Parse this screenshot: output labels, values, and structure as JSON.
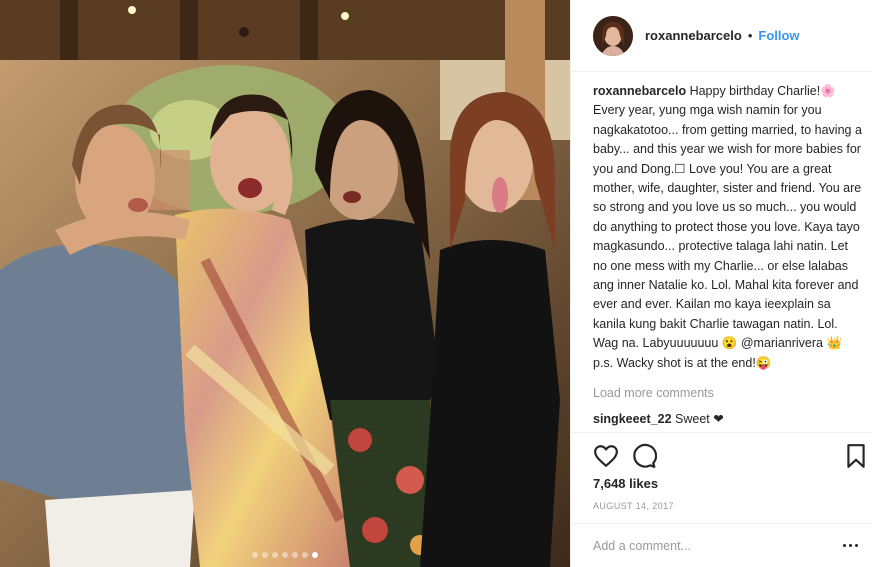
{
  "post": {
    "username": "roxannebarcelo",
    "follow_label": "Follow",
    "separator": "•",
    "caption_text": "Happy birthday Charlie!🌸 Every year, yung mga wish namin for you nagkakatotoo... from getting married, to having a baby... and this year we wish for more babies for you and Dong.☐ Love you! You are a great mother, wife, daughter, sister and friend. You are so strong and you love us so much... you would do anything to protect those you love. Kaya tayo magkasundo... protective talaga lahi natin. Let no one mess with my Charlie... or else lalabas ang inner Natalie ko. Lol. Mahal kita forever and ever and ever. Kailan mo kaya ieexplain sa kanila kung bakit Charlie tawagan natin. Lol. Wag na. Labyuuuuuuu 😮 @marianrivera 👑 p.s. Wacky shot is at the end!😜",
    "load_more_label": "Load more comments",
    "comments": [
      {
        "username": "singkeeet_22",
        "text": "Sweet ❤"
      }
    ],
    "likes": "7,648 likes",
    "date": "AUGUST 14, 2017",
    "add_comment_placeholder": "Add a comment...",
    "carousel": {
      "count": 7,
      "active_index": 6
    },
    "icons": {
      "like": "heart-icon",
      "comment": "comment-icon",
      "save": "bookmark-icon",
      "more": "more-options-icon"
    },
    "colors": {
      "link": "#3897f0",
      "muted": "#999999",
      "text": "#262626",
      "border": "#efefef"
    }
  }
}
